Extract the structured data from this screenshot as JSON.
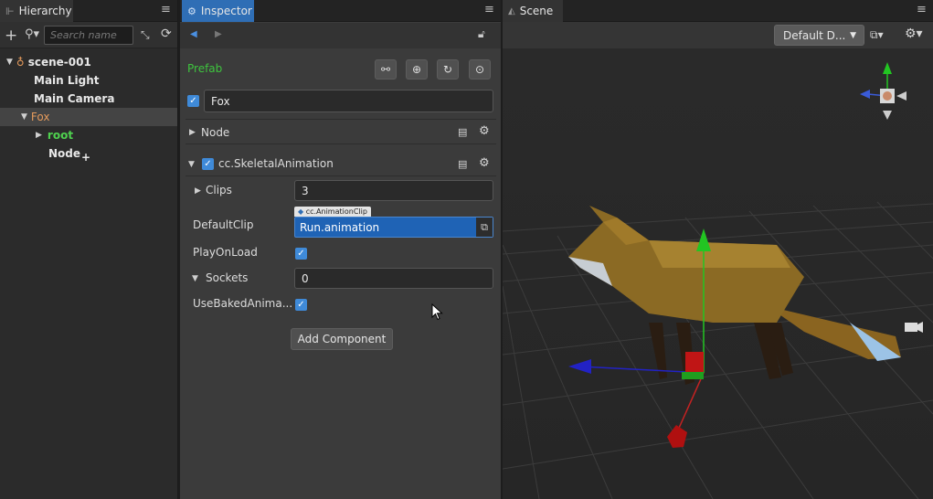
{
  "hierarchy": {
    "tab_label": "Hierarchy",
    "search_placeholder": "Search name",
    "items": [
      {
        "label": "scene-001"
      },
      {
        "label": "Main Light"
      },
      {
        "label": "Main Camera"
      },
      {
        "label": "Fox"
      },
      {
        "label": "root"
      },
      {
        "label": "Node"
      }
    ]
  },
  "inspector": {
    "tab_label": "Inspector",
    "prefab_label": "Prefab",
    "node_name": "Fox",
    "node_section": "Node",
    "component_name": "cc.SkeletalAnimation",
    "props": {
      "clips_label": "Clips",
      "clips_value": "3",
      "default_clip_label": "DefaultClip",
      "default_clip_type": "cc.AnimationClip",
      "default_clip_value": "Run.animation",
      "play_on_load_label": "PlayOnLoad",
      "sockets_label": "Sockets",
      "sockets_value": "0",
      "use_baked_label": "UseBakedAnima..."
    },
    "add_component_label": "Add Component",
    "colors": {
      "prefab": "#3ec43e",
      "accent": "#2f6eb5"
    }
  },
  "scene": {
    "tab_label": "Scene",
    "camera_dropdown": "Default D..."
  }
}
